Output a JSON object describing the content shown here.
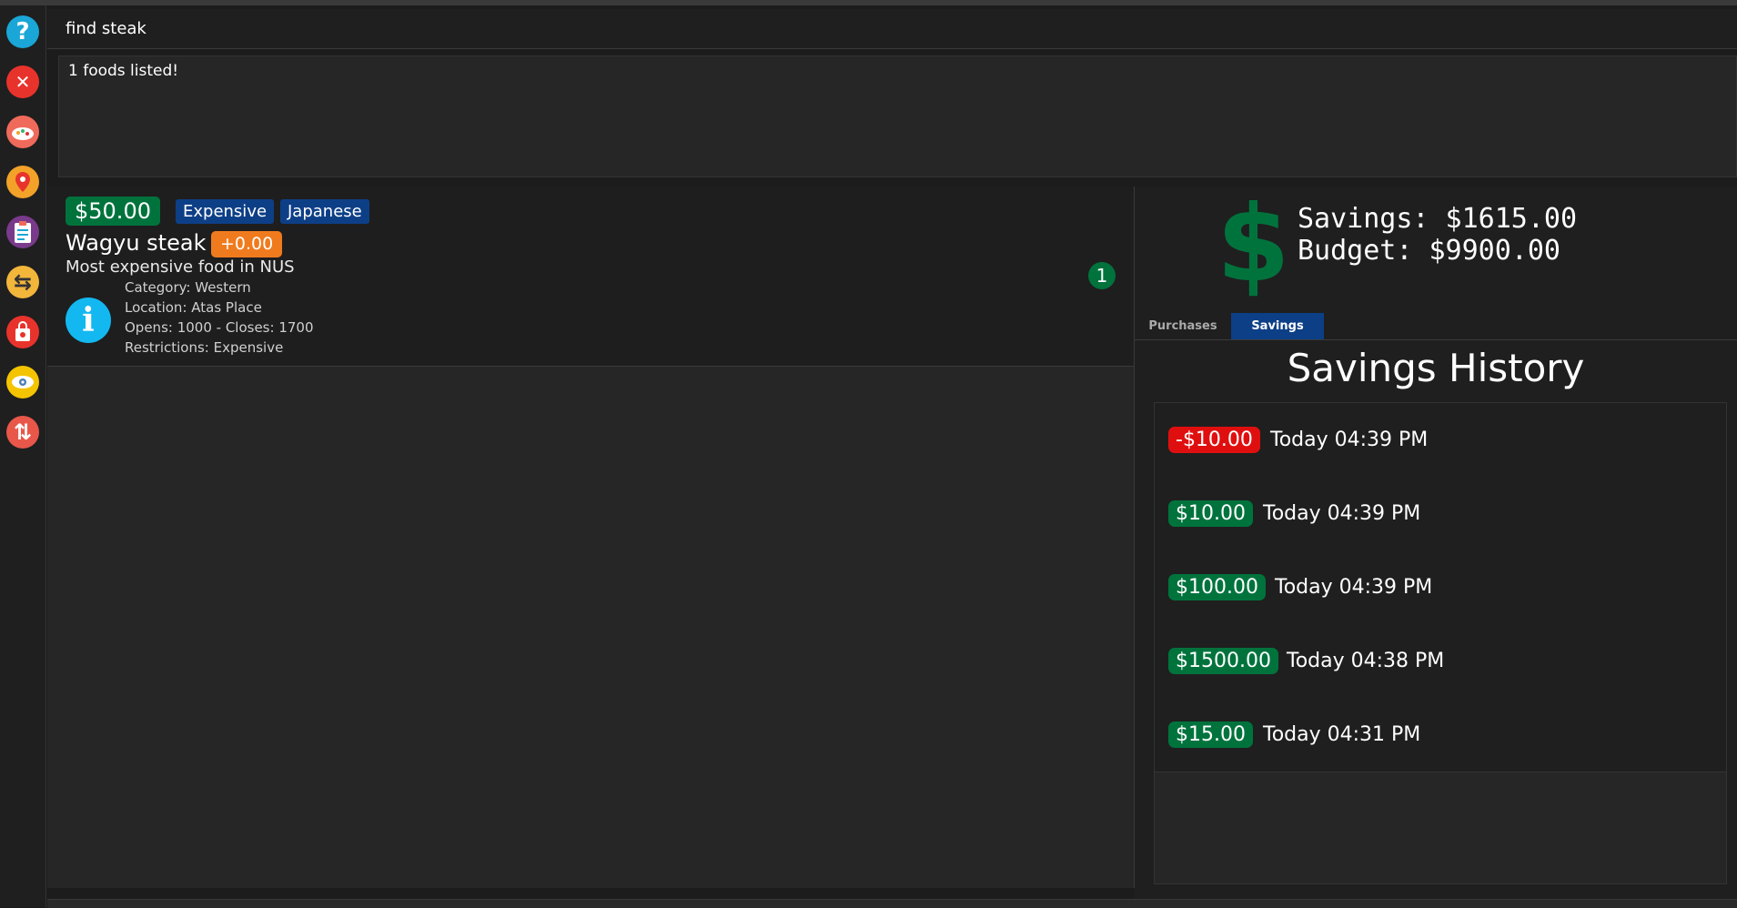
{
  "command": {
    "value": "find steak"
  },
  "result": {
    "text": "1 foods listed!"
  },
  "sidebar": {
    "items": [
      {
        "name": "help",
        "icon": "help-icon",
        "color": "#1aa6d6",
        "glyph": "?"
      },
      {
        "name": "exit",
        "icon": "close-icon",
        "color": "#e8332c",
        "glyph": "✕"
      },
      {
        "name": "food",
        "icon": "dish-icon",
        "color": "#f06a5b"
      },
      {
        "name": "location",
        "icon": "location-pin-icon",
        "color": "#f2a229"
      },
      {
        "name": "list",
        "icon": "clipboard-icon",
        "color": "#7a3a8c"
      },
      {
        "name": "swap",
        "icon": "swap-icon",
        "color": "#f2b63b",
        "glyph": "⇆"
      },
      {
        "name": "shop",
        "icon": "shopping-bag-icon",
        "color": "#e8332c"
      },
      {
        "name": "view",
        "icon": "eye-icon",
        "color": "#f5c400"
      },
      {
        "name": "sort",
        "icon": "sort-icon",
        "color": "#e8574a",
        "glyph": "⇅"
      }
    ]
  },
  "food_card": {
    "price": "$50.00",
    "tags": [
      "Expensive",
      "Japanese"
    ],
    "name": "Wagyu steak",
    "modifier": "+0.00",
    "description": "Most expensive food in NUS",
    "details": {
      "category": "Category: Western",
      "location": "Location: Atas Place",
      "hours": "Opens: 1000 - Closes: 1700",
      "restrictions": "Restrictions: Expensive"
    },
    "index": "1"
  },
  "summary": {
    "savings": "Savings: $1615.00",
    "budget": "Budget: $9900.00"
  },
  "tabs": [
    {
      "label": "Purchases",
      "active": false
    },
    {
      "label": "Savings",
      "active": true
    }
  ],
  "history": {
    "title": "Savings History",
    "items": [
      {
        "amount": "-$10.00",
        "time": "Today 04:39 PM",
        "negative": true
      },
      {
        "amount": "$10.00",
        "time": "Today 04:39 PM",
        "negative": false
      },
      {
        "amount": "$100.00",
        "time": "Today 04:39 PM",
        "negative": false
      },
      {
        "amount": "$1500.00",
        "time": "Today 04:38 PM",
        "negative": false
      },
      {
        "amount": "$15.00",
        "time": "Today 04:31 PM",
        "negative": false
      }
    ]
  },
  "colors": {
    "positive": "#00733d",
    "negative": "#e00f0f",
    "tag_blue": "#0d3f87",
    "modifier_orange": "#f07b1e",
    "info": "#13b8f0"
  }
}
